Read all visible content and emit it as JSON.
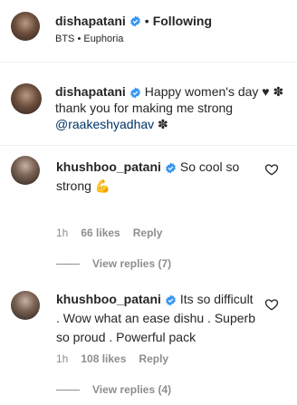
{
  "header": {
    "username": "dishapatani",
    "separator": "•",
    "follow_label": "Following",
    "subtitle": "BTS • Euphoria"
  },
  "caption": {
    "username": "dishapatani",
    "text": "Happy women's day ♥ ✽ thank you for making me strong ",
    "mention": "@raakeshyadhav",
    "tail": " ✽"
  },
  "comments": [
    {
      "username": "khushboo_patani",
      "text": "So cool so strong 💪",
      "time": "1h",
      "likes": "66 likes",
      "reply_label": "Reply",
      "view_replies": "View replies (7)"
    },
    {
      "username": "khushboo_patani",
      "text": "Its so difficult . Wow what an ease dishu . Superb so proud . Powerful pack",
      "time": "1h",
      "likes": "108 likes",
      "reply_label": "Reply",
      "view_replies": "View replies (4)"
    }
  ],
  "colors": {
    "verified": "#3897f0",
    "text": "#262626",
    "muted": "#8e8e8e",
    "mention": "#003569"
  }
}
